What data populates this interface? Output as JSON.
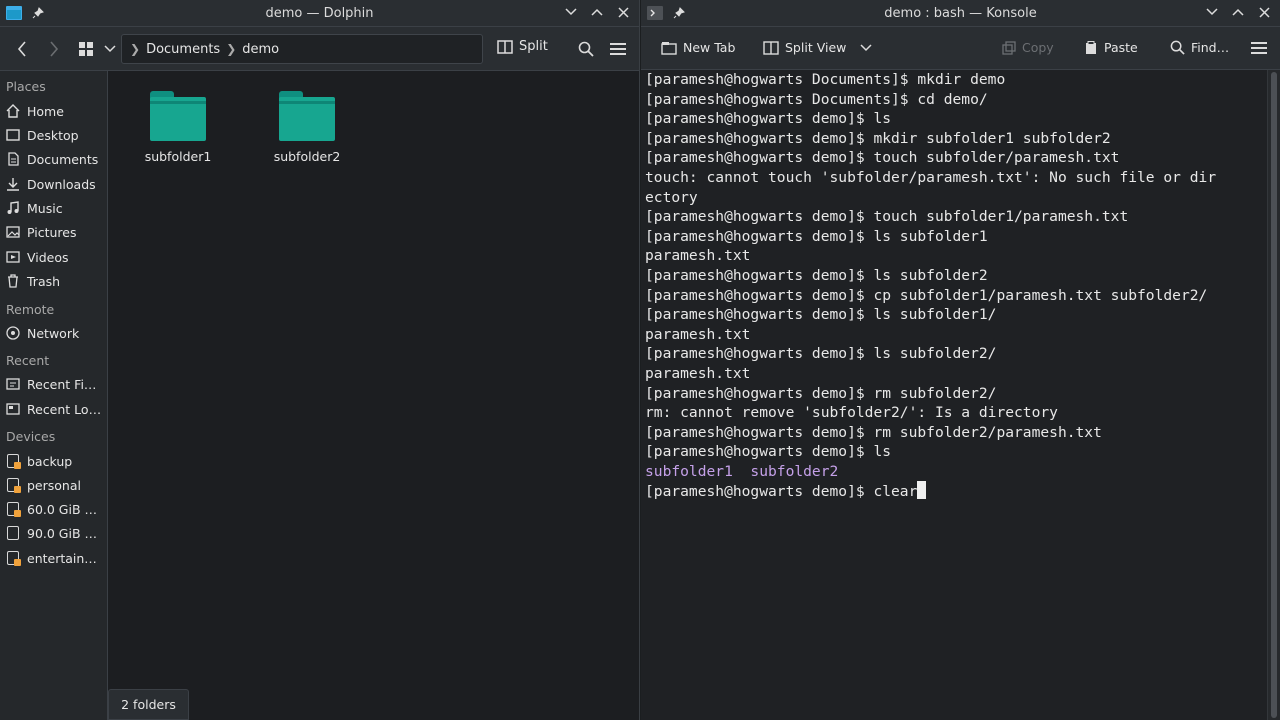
{
  "dolphin": {
    "title": "demo — Dolphin",
    "breadcrumb": [
      "Documents",
      "demo"
    ],
    "split_label": "Split",
    "places": {
      "header_places": "Places",
      "header_remote": "Remote",
      "header_recent": "Recent",
      "header_devices": "Devices",
      "items": [
        {
          "label": "Home",
          "icon": "home-icon"
        },
        {
          "label": "Desktop",
          "icon": "desktop-icon"
        },
        {
          "label": "Documents",
          "icon": "documents-icon"
        },
        {
          "label": "Downloads",
          "icon": "download-icon"
        },
        {
          "label": "Music",
          "icon": "music-icon"
        },
        {
          "label": "Pictures",
          "icon": "pictures-icon"
        },
        {
          "label": "Videos",
          "icon": "videos-icon"
        },
        {
          "label": "Trash",
          "icon": "trash-icon"
        }
      ],
      "remote": [
        {
          "label": "Network",
          "icon": "network-icon"
        }
      ],
      "recent": [
        {
          "label": "Recent Fi…",
          "icon": "recent-files-icon"
        },
        {
          "label": "Recent Lo…",
          "icon": "recent-locations-icon"
        }
      ],
      "devices": [
        {
          "label": "backup",
          "icon": "drive-icon"
        },
        {
          "label": "personal",
          "icon": "drive-icon"
        },
        {
          "label": "60.0 GiB …",
          "icon": "drive-icon"
        },
        {
          "label": "90.0 GiB …",
          "icon": "drive-icon"
        },
        {
          "label": "entertain…",
          "icon": "drive-icon"
        }
      ]
    },
    "folders": [
      {
        "name": "subfolder1"
      },
      {
        "name": "subfolder2"
      }
    ],
    "status": "2 folders",
    "folder_color": "#17a690"
  },
  "konsole": {
    "title": "demo : bash — Konsole",
    "toolbar": {
      "new_tab": "New Tab",
      "split_view": "Split View",
      "copy": "Copy",
      "paste": "Paste",
      "find": "Find…"
    },
    "lines": [
      "[paramesh@hogwarts Documents]$ mkdir demo",
      "[paramesh@hogwarts Documents]$ cd demo/",
      "[paramesh@hogwarts demo]$ ls",
      "[paramesh@hogwarts demo]$ mkdir subfolder1 subfolder2",
      "[paramesh@hogwarts demo]$ touch subfolder/paramesh.txt",
      "touch: cannot touch 'subfolder/paramesh.txt': No such file or dir",
      "ectory",
      "[paramesh@hogwarts demo]$ touch subfolder1/paramesh.txt",
      "[paramesh@hogwarts demo]$ ls subfolder1",
      "paramesh.txt",
      "[paramesh@hogwarts demo]$ ls subfolder2",
      "[paramesh@hogwarts demo]$ cp subfolder1/paramesh.txt subfolder2/",
      "[paramesh@hogwarts demo]$ ls subfolder1/",
      "paramesh.txt",
      "[paramesh@hogwarts demo]$ ls subfolder2/",
      "paramesh.txt",
      "[paramesh@hogwarts demo]$ rm subfolder2/",
      "rm: cannot remove 'subfolder2/': Is a directory",
      "[paramesh@hogwarts demo]$ rm subfolder2/paramesh.txt",
      "[paramesh@hogwarts demo]$ ls"
    ],
    "ls_output": "subfolder1  subfolder2",
    "prompt_line": "[paramesh@hogwarts demo]$ clear",
    "dir_color": "#c4a0e8"
  }
}
